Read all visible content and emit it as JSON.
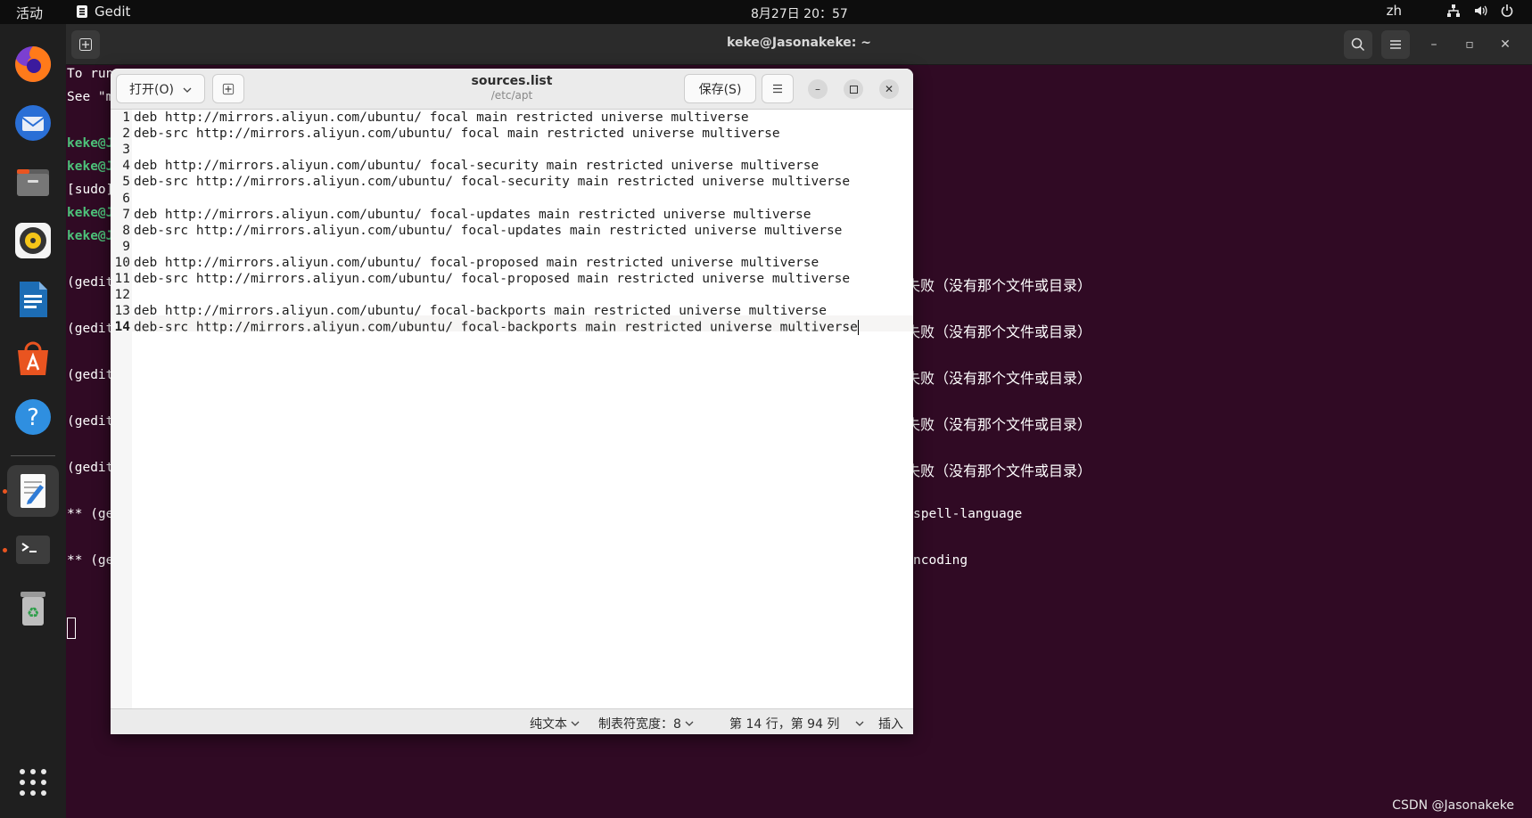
{
  "topbar": {
    "activities": "活动",
    "app_name": "Gedit",
    "clock": "8月27日  20：57",
    "language": "zh"
  },
  "dock": {
    "items": [
      "firefox",
      "thunderbird",
      "files",
      "rhythmbox",
      "libreoffice-writer",
      "app-center",
      "help",
      "gedit",
      "terminal",
      "trash"
    ],
    "show_apps_icon": "grid-icon"
  },
  "terminal": {
    "title": "keke@Jasonakeke: ~",
    "lines_left": [
      {
        "text": "To run",
        "style": "normal"
      },
      {
        "text": "See \"m",
        "style": "normal"
      },
      {
        "text": "",
        "style": "normal"
      },
      {
        "text": "keke@J",
        "style": "green"
      },
      {
        "text": "keke@J",
        "style": "green"
      },
      {
        "text": "[sudo]",
        "style": "normal"
      },
      {
        "text": "keke@J",
        "style": "green"
      },
      {
        "text": "keke@J",
        "style": "green"
      }
    ],
    "gedit_lines": [
      "(gedit",
      "(gedit",
      "(gedit",
      "(gedit",
      "(gedit"
    ],
    "gedit_errors": [
      "失败（没有那个文件或目录）",
      "失败（没有那个文件或目录）",
      "失败（没有那个文件或目录）",
      "失败（没有那个文件或目录）",
      "失败（没有那个文件或目录）"
    ],
    "ge_lines": [
      "** (ge",
      "** (ge"
    ],
    "ge_tails": [
      "spell-language",
      "ncoding"
    ]
  },
  "gedit": {
    "open_label": "打开(O)",
    "save_label": "保存(S)",
    "file_name": "sources.list",
    "file_path": "/etc/apt",
    "lines": [
      "deb http://mirrors.aliyun.com/ubuntu/ focal main restricted universe multiverse",
      "deb-src http://mirrors.aliyun.com/ubuntu/ focal main restricted universe multiverse",
      "",
      "deb http://mirrors.aliyun.com/ubuntu/ focal-security main restricted universe multiverse",
      "deb-src http://mirrors.aliyun.com/ubuntu/ focal-security main restricted universe multiverse",
      "",
      "deb http://mirrors.aliyun.com/ubuntu/ focal-updates main restricted universe multiverse",
      "deb-src http://mirrors.aliyun.com/ubuntu/ focal-updates main restricted universe multiverse",
      "",
      "deb http://mirrors.aliyun.com/ubuntu/ focal-proposed main restricted universe multiverse",
      "deb-src http://mirrors.aliyun.com/ubuntu/ focal-proposed main restricted universe multiverse",
      "",
      "deb http://mirrors.aliyun.com/ubuntu/ focal-backports main restricted universe multiverse",
      "deb-src http://mirrors.aliyun.com/ubuntu/ focal-backports main restricted universe multiverse"
    ],
    "current_line": 14,
    "status": {
      "language": "纯文本",
      "tab_width": "制表符宽度：8",
      "position": "第 14 行，第 94 列",
      "mode": "插入"
    }
  },
  "watermark": "CSDN @Jasonakeke"
}
